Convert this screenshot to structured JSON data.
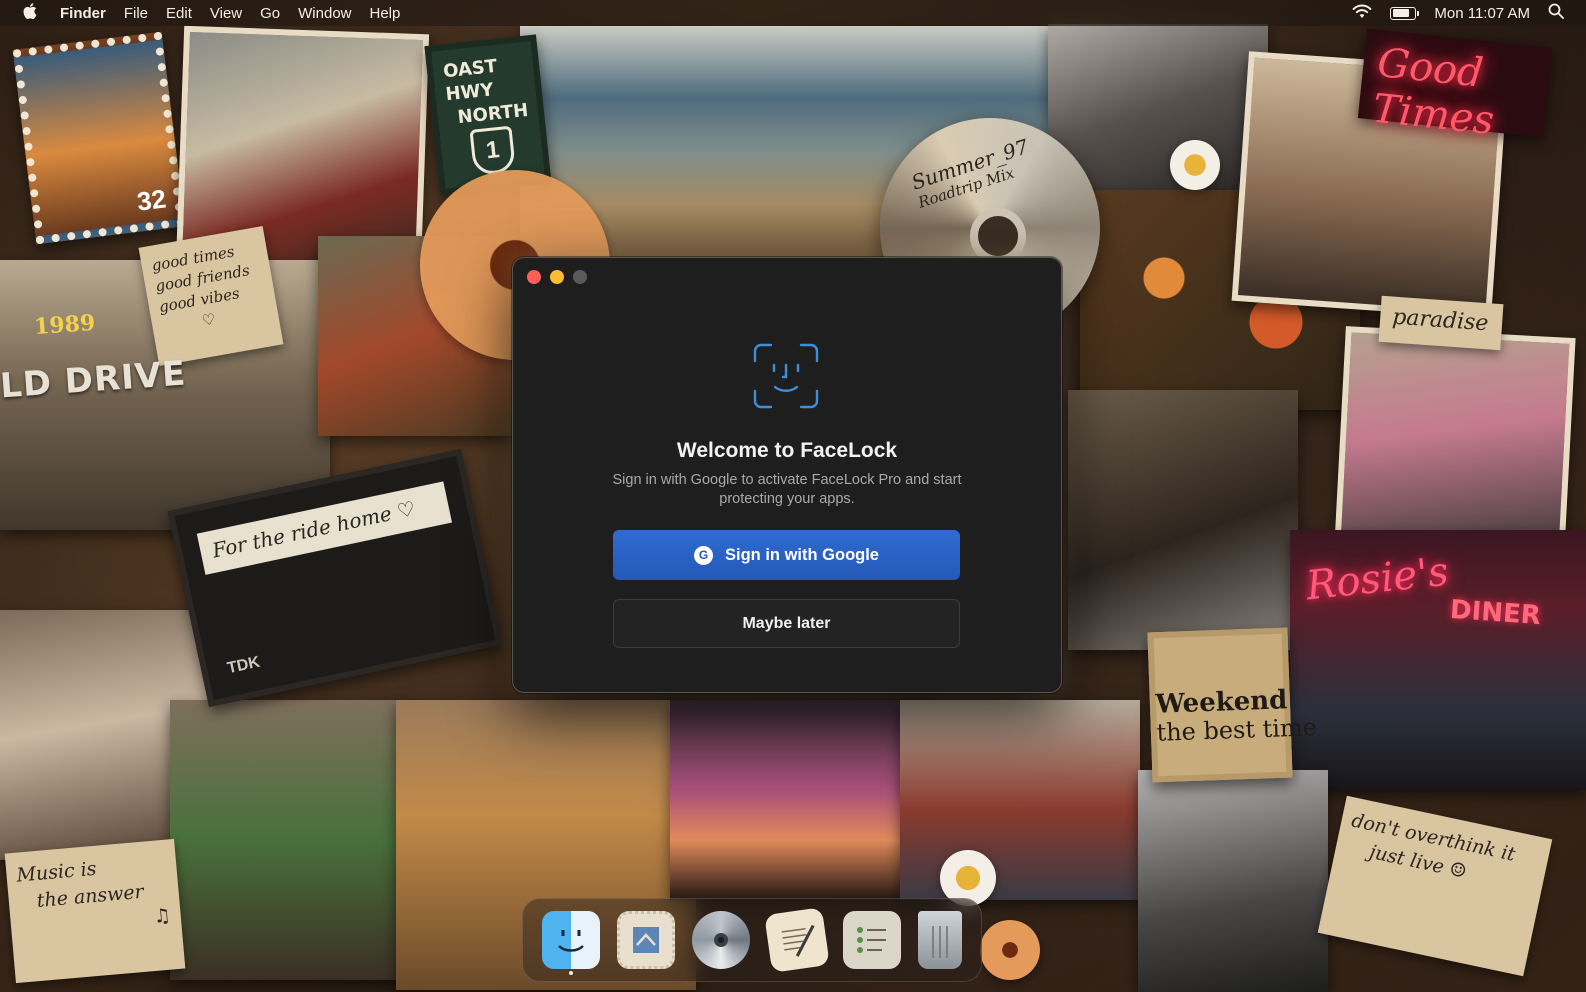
{
  "menubar": {
    "app_name": "Finder",
    "menus": [
      "File",
      "Edit",
      "View",
      "Go",
      "Window",
      "Help"
    ],
    "clock": "Mon 11:07 AM",
    "battery_level": 0.8,
    "icons": [
      "apple-icon",
      "wifi-icon",
      "battery-icon",
      "search-icon"
    ]
  },
  "wallpaper": {
    "stamp_number": "32",
    "sign": {
      "line1": "OAST HWY",
      "line2": "NORTH",
      "route": "1"
    },
    "cd_label": {
      "line1": "Summer_97",
      "line2": "Roadtrip Mix"
    },
    "note_good": {
      "line1": "good times",
      "line2": "good friends",
      "line3": "good vibes",
      "mark": "♡"
    },
    "year": "1989",
    "drive_sign": "LD DRIVE",
    "tape": {
      "label": "For the ride home ♡",
      "brand": "TDK"
    },
    "neon_good": "Good Times",
    "paradise": "paradise",
    "neon_rosie": "Rosie's",
    "neon_diner": "DINER",
    "news": {
      "headline": "Weekend",
      "sub": "the best time"
    },
    "note_music": {
      "line1": "Music is",
      "line2": "the answer",
      "mark": "♫"
    },
    "note_overthink": {
      "line1": "don't overthink it",
      "line2": "just live ☺"
    }
  },
  "dialog": {
    "title": "Welcome to FaceLock",
    "subtitle": "Sign in with Google to activate FaceLock Pro and start protecting your apps.",
    "primary_label": "Sign in with Google",
    "secondary_label": "Maybe later",
    "icon": "face-id-icon",
    "google_glyph": "G"
  },
  "dock": {
    "items": [
      "finder-icon",
      "mail-icon",
      "dvd-player-icon",
      "textedit-icon",
      "reminders-icon",
      "trash-icon"
    ]
  },
  "colors": {
    "accent_blue": "#2f6bd0",
    "dialog_bg": "#1e1e1f",
    "face_icon": "#3e8fd8",
    "close": "#ff5f57",
    "minimize": "#febc2e"
  }
}
